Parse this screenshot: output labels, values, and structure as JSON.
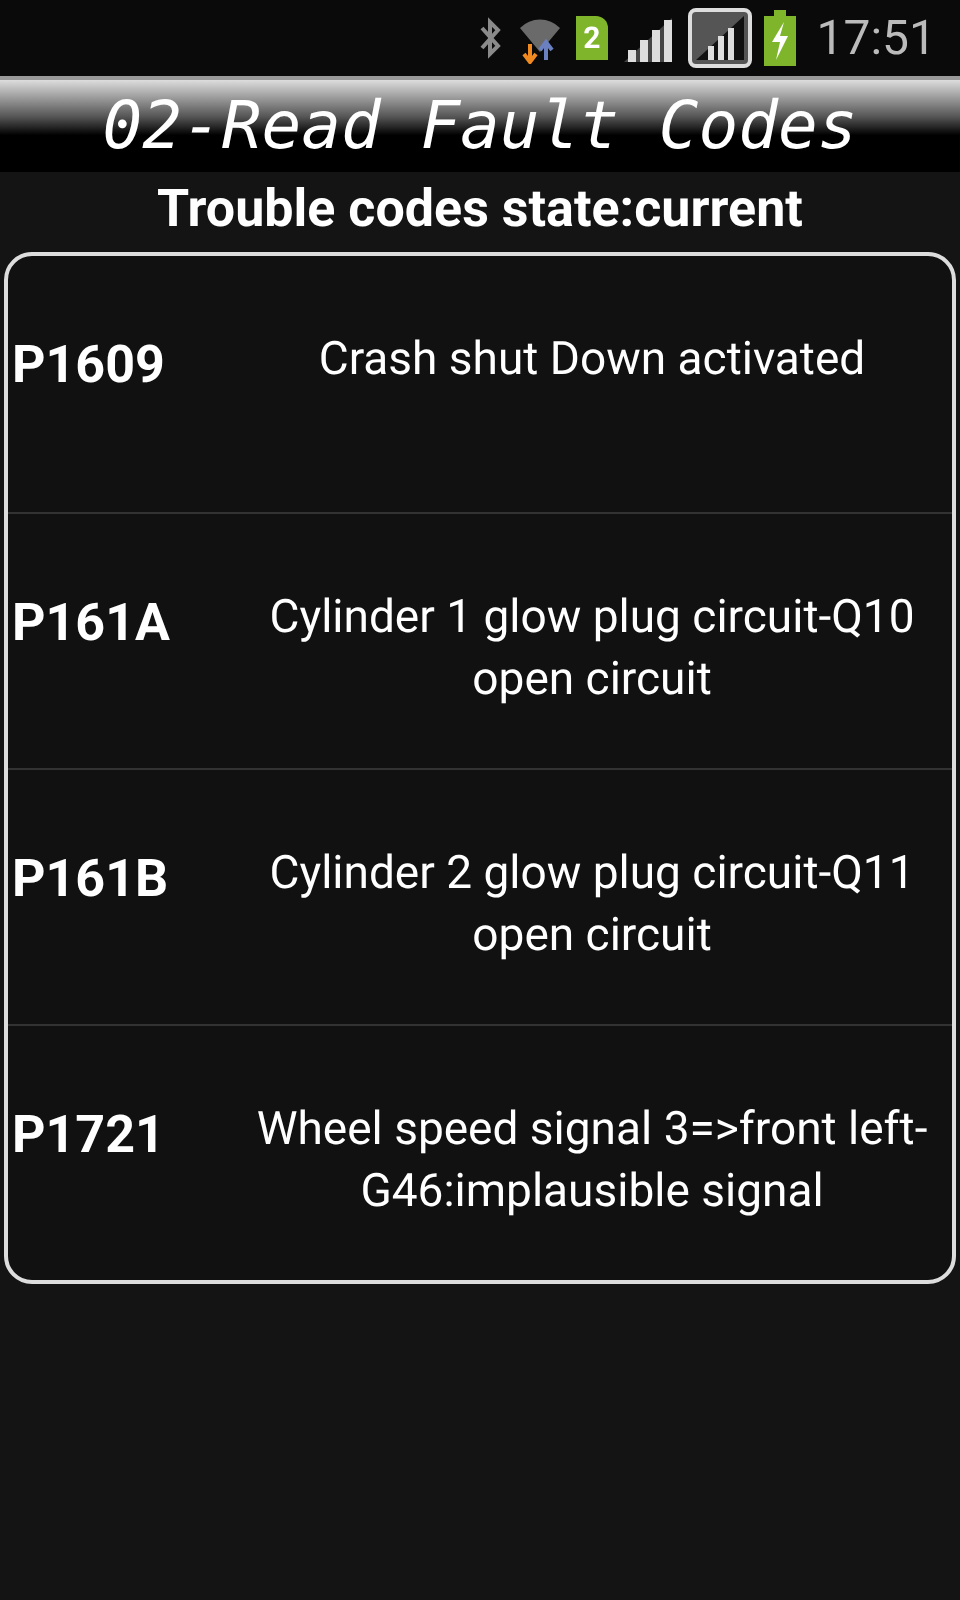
{
  "status_bar": {
    "sim_badge": "2",
    "time": "17:51"
  },
  "title": "02-Read Fault Codes",
  "subtitle": "Trouble codes state:current",
  "fault_codes": [
    {
      "code": "P1609",
      "description": "Crash shut Down activated"
    },
    {
      "code": "P161A",
      "description": "Cylinder 1 glow plug circuit-Q10 open circuit"
    },
    {
      "code": "P161B",
      "description": "Cylinder 2 glow plug circuit-Q11 open circuit"
    },
    {
      "code": "P1721",
      "description": "Wheel speed signal 3=>front left-G46:implausible signal"
    }
  ]
}
